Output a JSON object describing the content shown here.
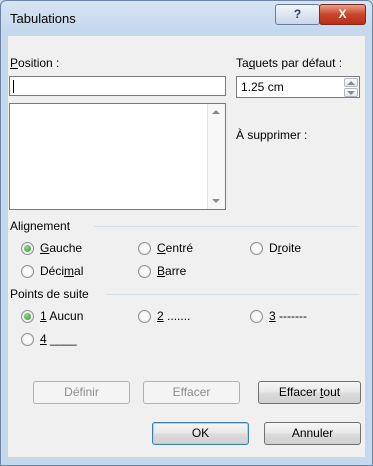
{
  "window": {
    "title": "Tabulations",
    "help_glyph": "?",
    "close_glyph": "X"
  },
  "position": {
    "label_first": "P",
    "label_rest": "osition :",
    "value": "",
    "list_items": []
  },
  "default_tabs": {
    "label_pre": "Ta",
    "label_u": "q",
    "label_post": "uets par défaut :",
    "value": "1.25 cm"
  },
  "to_delete": {
    "label": "À supprimer :"
  },
  "alignment": {
    "title": "Alignement",
    "options": [
      {
        "pre": "",
        "u": "G",
        "post": "auche",
        "checked": true
      },
      {
        "pre": "",
        "u": "C",
        "post": "entré",
        "checked": false
      },
      {
        "pre": "D",
        "u": "r",
        "post": "oite",
        "checked": false
      },
      {
        "pre": "Déci",
        "u": "m",
        "post": "al",
        "checked": false
      },
      {
        "pre": "",
        "u": "B",
        "post": "arre",
        "checked": false
      }
    ]
  },
  "leader": {
    "title": "Points de suite",
    "options": [
      {
        "u": "1",
        "post": " Aucun",
        "checked": true
      },
      {
        "u": "2",
        "post": " .......",
        "checked": false
      },
      {
        "u": "3",
        "post": " -------",
        "checked": false
      },
      {
        "u": "4",
        "post": " ____",
        "checked": false
      }
    ]
  },
  "buttons": {
    "set": "Définir",
    "clear": "Effacer",
    "clear_all_pre": "Effacer ",
    "clear_all_u": "t",
    "clear_all_post": "out",
    "ok": "OK",
    "cancel": "Annuler"
  }
}
